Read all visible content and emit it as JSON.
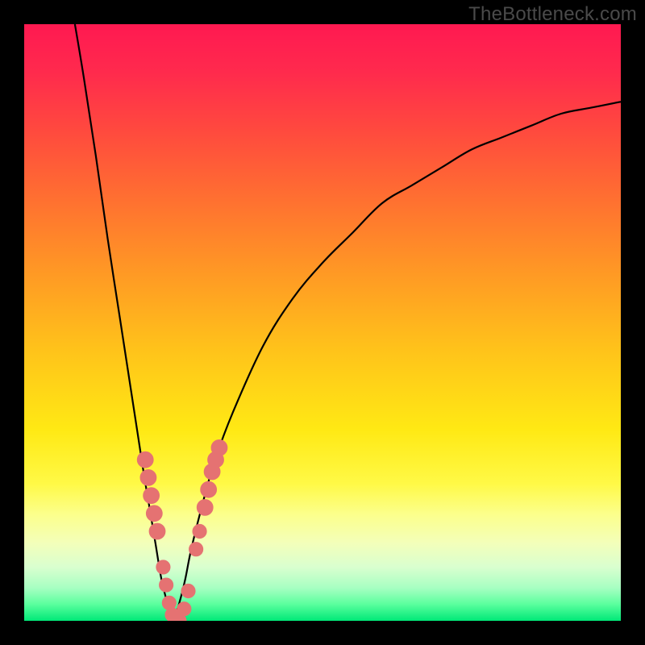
{
  "watermark": "TheBottleneck.com",
  "gradient_stops": [
    {
      "offset": 0.0,
      "color": "#ff1951"
    },
    {
      "offset": 0.08,
      "color": "#ff2a4d"
    },
    {
      "offset": 0.18,
      "color": "#ff4a3e"
    },
    {
      "offset": 0.3,
      "color": "#ff7230"
    },
    {
      "offset": 0.42,
      "color": "#ff9a24"
    },
    {
      "offset": 0.55,
      "color": "#ffc41a"
    },
    {
      "offset": 0.68,
      "color": "#ffe914"
    },
    {
      "offset": 0.77,
      "color": "#fff946"
    },
    {
      "offset": 0.82,
      "color": "#fcff8a"
    },
    {
      "offset": 0.87,
      "color": "#f3ffba"
    },
    {
      "offset": 0.91,
      "color": "#d9ffcf"
    },
    {
      "offset": 0.945,
      "color": "#a7ffc2"
    },
    {
      "offset": 0.972,
      "color": "#5bff9e"
    },
    {
      "offset": 1.0,
      "color": "#00e877"
    }
  ],
  "chart_data": {
    "type": "line",
    "title": "",
    "xlabel": "",
    "ylabel": "",
    "xlim": [
      0,
      100
    ],
    "ylim": [
      0,
      100
    ],
    "grid": false,
    "legend": false,
    "curve_minimum_x": 25,
    "left_branch": {
      "name": "left",
      "x": [
        8.5,
        10,
        12,
        14,
        16,
        18,
        20,
        21,
        22,
        23,
        24,
        25
      ],
      "y": [
        100,
        91,
        78,
        64,
        51,
        38,
        25,
        19,
        13,
        7,
        3,
        0
      ]
    },
    "right_branch": {
      "name": "right",
      "x": [
        25,
        26,
        27,
        28,
        30,
        32,
        35,
        40,
        45,
        50,
        55,
        60,
        65,
        70,
        75,
        80,
        85,
        90,
        95,
        100
      ],
      "y": [
        0,
        3,
        7,
        12,
        20,
        27,
        35,
        46,
        54,
        60,
        65,
        70,
        73,
        76,
        79,
        81,
        83,
        85,
        86,
        87
      ]
    },
    "markers": [
      {
        "branch": "left",
        "x": 20.3,
        "y": 27,
        "size": 3.0
      },
      {
        "branch": "left",
        "x": 20.8,
        "y": 24,
        "size": 3.0
      },
      {
        "branch": "left",
        "x": 21.3,
        "y": 21,
        "size": 3.0
      },
      {
        "branch": "left",
        "x": 21.8,
        "y": 18,
        "size": 3.0
      },
      {
        "branch": "left",
        "x": 22.3,
        "y": 15,
        "size": 3.0
      },
      {
        "branch": "left",
        "x": 23.3,
        "y": 9,
        "size": 2.6
      },
      {
        "branch": "left",
        "x": 23.8,
        "y": 6,
        "size": 2.6
      },
      {
        "branch": "left",
        "x": 24.3,
        "y": 3,
        "size": 2.6
      },
      {
        "branch": "left",
        "x": 24.8,
        "y": 1,
        "size": 2.6
      },
      {
        "branch": "min",
        "x": 25.3,
        "y": 0,
        "size": 2.6
      },
      {
        "branch": "min",
        "x": 26.0,
        "y": 0,
        "size": 2.6
      },
      {
        "branch": "right",
        "x": 26.8,
        "y": 2,
        "size": 2.6
      },
      {
        "branch": "right",
        "x": 27.5,
        "y": 5,
        "size": 2.6
      },
      {
        "branch": "right",
        "x": 28.8,
        "y": 12,
        "size": 2.6
      },
      {
        "branch": "right",
        "x": 29.4,
        "y": 15,
        "size": 2.6
      },
      {
        "branch": "right",
        "x": 30.3,
        "y": 19,
        "size": 3.0
      },
      {
        "branch": "right",
        "x": 30.9,
        "y": 22,
        "size": 3.0
      },
      {
        "branch": "right",
        "x": 31.5,
        "y": 25,
        "size": 3.0
      },
      {
        "branch": "right",
        "x": 32.1,
        "y": 27,
        "size": 3.0
      },
      {
        "branch": "right",
        "x": 32.7,
        "y": 29,
        "size": 3.0
      }
    ]
  }
}
